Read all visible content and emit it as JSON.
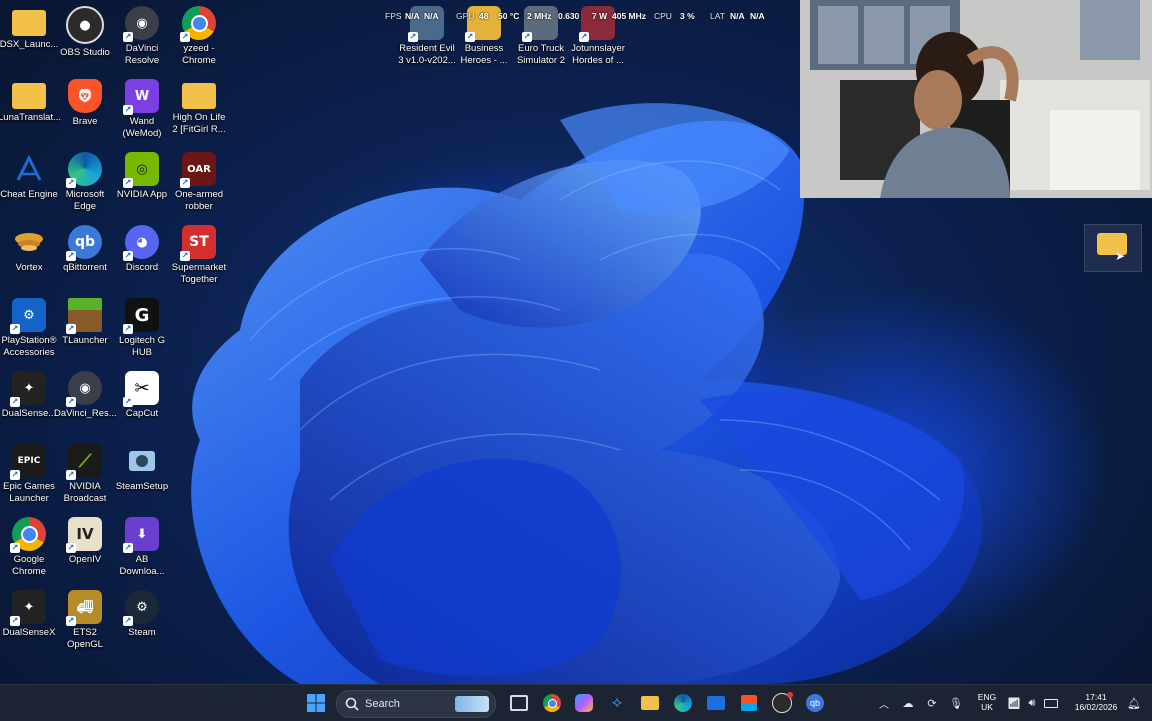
{
  "desktop": {
    "icons": [
      {
        "label": "DSX_Launc...",
        "icon": "folder-icon",
        "color": "#f3c04a"
      },
      {
        "label": "OBS Studio",
        "icon": "obs-icon",
        "color": "#2b2b2b"
      },
      {
        "label": "DaVinci\nResolve",
        "icon": "davinci-resolve-icon",
        "color": "#3a3f4a"
      },
      {
        "label": "yzeed -\nChrome",
        "icon": "chrome-icon",
        "color": "#ffffff"
      },
      {
        "label": "LunaTranslat...",
        "icon": "folder-icon",
        "color": "#f3c04a"
      },
      {
        "label": "Brave",
        "icon": "brave-icon",
        "color": "#fb542b"
      },
      {
        "label": "Wand\n(WeMod)",
        "icon": "wand-icon",
        "color": "#7b3fe4"
      },
      {
        "label": "High On Life\n2 [FitGirl R...",
        "icon": "folder-icon",
        "color": "#f3c04a"
      },
      {
        "label": "Cheat Engine",
        "icon": "cheat-engine-icon",
        "color": "#1c6bd6"
      },
      {
        "label": "Microsoft\nEdge",
        "icon": "edge-icon",
        "color": "#1aa5d8"
      },
      {
        "label": "NVIDIA App",
        "icon": "nvidia-icon",
        "color": "#1a1a1a"
      },
      {
        "label": "One-armed\nrobber",
        "icon": "one-armed-robber-icon",
        "color": "#6b1515"
      },
      {
        "label": "Vortex",
        "icon": "vortex-icon",
        "color": "#e0a12c"
      },
      {
        "label": "qBittorrent",
        "icon": "qbittorrent-icon",
        "color": "#3b78d8"
      },
      {
        "label": "Discord",
        "icon": "discord-icon",
        "color": "#5865f2"
      },
      {
        "label": "Supermarket\nTogether",
        "icon": "supermarket-together-icon",
        "color": "#d32f2f"
      },
      {
        "label": "PlayStation®\nAccessories",
        "icon": "playstation-accessories-icon",
        "color": "#1464c8"
      },
      {
        "label": "TLauncher",
        "icon": "tlauncher-icon",
        "color": "#5b8c2a"
      },
      {
        "label": "Logitech G\nHUB",
        "icon": "logitech-g-hub-icon",
        "color": "#111111"
      },
      {
        "label": "DualSense...",
        "icon": "controller-icon",
        "color": "#222222"
      },
      {
        "label": "DaVinci_Res...",
        "icon": "davinci-resolve-icon",
        "color": "#3a3f4a"
      },
      {
        "label": "CapCut",
        "icon": "capcut-icon",
        "color": "#ffffff"
      },
      {
        "label": "Epic Games\nLauncher",
        "icon": "epic-games-icon",
        "color": "#1b1b1b"
      },
      {
        "label": "NVIDIA\nBroadcast",
        "icon": "nvidia-broadcast-icon",
        "color": "#1a1a1a"
      },
      {
        "label": "SteamSetup",
        "icon": "steam-setup-icon",
        "color": "#2a475e"
      },
      {
        "label": "Google\nChrome",
        "icon": "chrome-icon",
        "color": "#ffffff"
      },
      {
        "label": "OpenIV",
        "icon": "openiv-icon",
        "color": "#e8e0c8"
      },
      {
        "label": "AB\nDownloa...",
        "icon": "ab-download-icon",
        "color": "#6a3fd0"
      },
      {
        "label": "DualSenseX",
        "icon": "controller-icon",
        "color": "#222222"
      },
      {
        "label": "ETS2 OpenGL",
        "icon": "ets2-icon",
        "color": "#b78a2a"
      },
      {
        "label": "Steam",
        "icon": "steam-icon",
        "color": "#1b2838"
      },
      {
        "label": "Resident Evil\n3 v1.0-v202...",
        "icon": "resident-evil-icon",
        "color": "#4a6a8a"
      },
      {
        "label": "Business\nHeroes - ...",
        "icon": "business-heroes-icon",
        "color": "#e4b23a"
      },
      {
        "label": "Euro Truck\nSimulator 2",
        "icon": "euro-truck-icon",
        "color": "#5b6b7b"
      },
      {
        "label": "Jotunnslayer\nHordes of ...",
        "icon": "jotunnslayer-icon",
        "color": "#8a2a3a"
      }
    ],
    "overlay": {
      "fps_label": "FPS",
      "fps_value": "N/A",
      "fps_value2": "N/A",
      "gpu_label": "GPU",
      "gpu_temp": "48",
      "gpu_temp_unit": "50 °C",
      "gpu_clock": "2 MHz",
      "gpu_volt": "0.630",
      "gpu_power": "7 W",
      "gpu_mem": "405 MHz",
      "cpu_label": "CPU",
      "cpu_value": "3 %",
      "lat_label": "LAT",
      "lat_value": "N/A",
      "lat_value2": "N/A"
    },
    "selected_folder_icon": "folder-icon"
  },
  "taskbar": {
    "search_label": "Search",
    "language_top": "ENG",
    "language_bottom": "UK",
    "time": "17:41",
    "date": "16/02/2026",
    "accent": "#1d6fe0"
  }
}
